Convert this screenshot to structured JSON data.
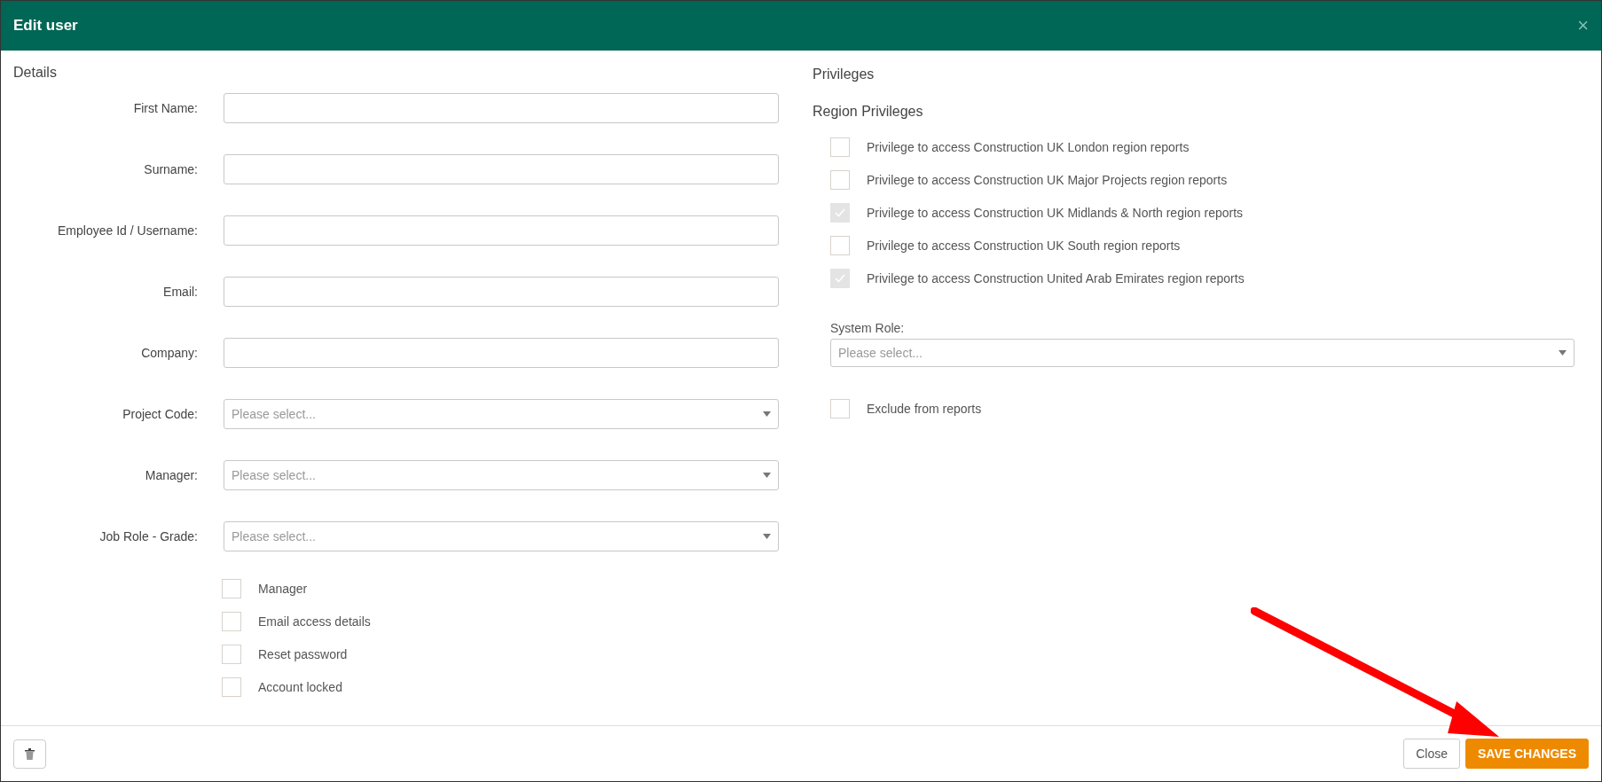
{
  "window": {
    "title": "Edit user",
    "close": "×"
  },
  "details": {
    "heading": "Details",
    "fields": [
      {
        "label": "First Name:",
        "kind": "text"
      },
      {
        "label": "Surname:",
        "kind": "text"
      },
      {
        "label": "Employee Id / Username:",
        "kind": "text"
      },
      {
        "label": "Email:",
        "kind": "text"
      },
      {
        "label": "Company:",
        "kind": "text"
      },
      {
        "label": "Project Code:",
        "kind": "select",
        "placeholder": "Please select..."
      },
      {
        "label": "Manager:",
        "kind": "select",
        "placeholder": "Please select..."
      },
      {
        "label": "Job Role - Grade:",
        "kind": "select",
        "placeholder": "Please select..."
      }
    ],
    "options": [
      {
        "label": "Manager",
        "checked": false
      },
      {
        "label": "Email access details",
        "checked": false
      },
      {
        "label": "Reset password",
        "checked": false
      },
      {
        "label": "Account locked",
        "checked": false
      }
    ]
  },
  "privileges": {
    "heading": "Privileges",
    "subheading": "Region Privileges",
    "regions": [
      {
        "label": "Privilege to access Construction UK London region reports",
        "checked": false
      },
      {
        "label": "Privilege to access Construction UK Major Projects region reports",
        "checked": false
      },
      {
        "label": "Privilege to access Construction UK Midlands & North region reports",
        "checked": true
      },
      {
        "label": "Privilege to access Construction UK South region reports",
        "checked": false
      },
      {
        "label": "Privilege to access Construction United Arab Emirates region reports",
        "checked": true
      }
    ],
    "system_role": {
      "label": "System Role:",
      "placeholder": "Please select..."
    },
    "exclude": {
      "label": "Exclude from reports",
      "checked": false
    }
  },
  "footer": {
    "buttons": [
      {
        "label": "Close",
        "kind": "secondary"
      },
      {
        "label": "SAVE CHANGES",
        "kind": "primary"
      }
    ]
  }
}
